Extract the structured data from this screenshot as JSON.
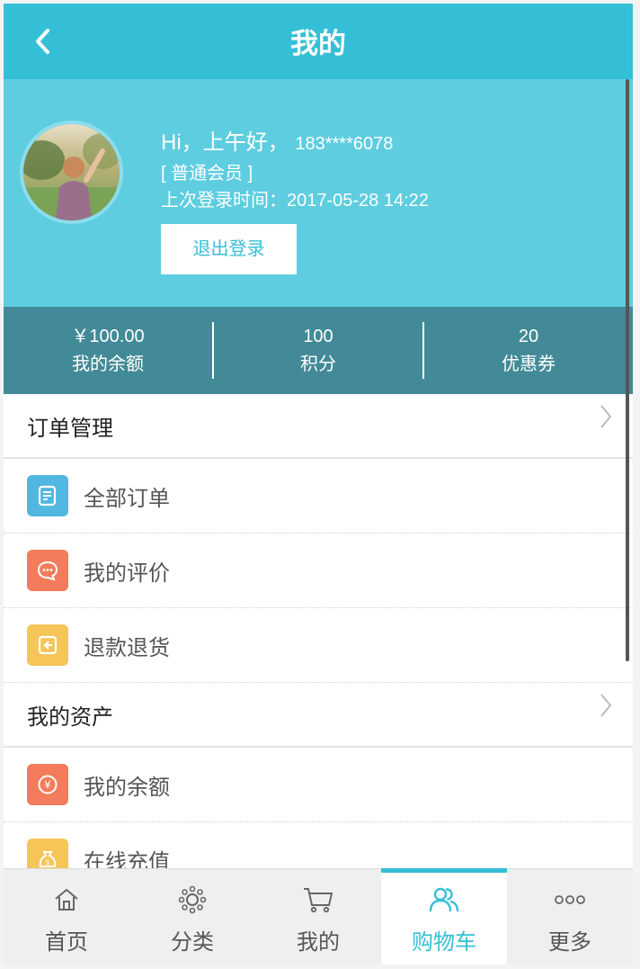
{
  "header": {
    "title": "我的"
  },
  "profile": {
    "greeting": "Hi，上午好，",
    "phone": "183****6078",
    "level": "[ 普通会员 ]",
    "last_login": "上次登录时间：2017-05-28 14:22",
    "logout_label": "退出登录"
  },
  "stats": [
    {
      "value": "￥100.00",
      "label": "我的余额"
    },
    {
      "value": "100",
      "label": "积分"
    },
    {
      "value": "20",
      "label": "优惠券"
    }
  ],
  "sections": {
    "orders": {
      "title": "订单管理",
      "items": [
        {
          "label": "全部订单",
          "icon": "order-list-icon",
          "color": "#52b7e0"
        },
        {
          "label": "我的评价",
          "icon": "comment-icon",
          "color": "#f27c5b"
        },
        {
          "label": "退款退货",
          "icon": "refund-icon",
          "color": "#f6c558"
        }
      ]
    },
    "assets": {
      "title": "我的资产",
      "items": [
        {
          "label": "我的余额",
          "icon": "yen-coin-icon",
          "color": "#f27c5b"
        },
        {
          "label": "在线充值",
          "icon": "money-bag-icon",
          "color": "#f6c558"
        }
      ]
    }
  },
  "nav": [
    {
      "label": "首页",
      "icon": "home-icon"
    },
    {
      "label": "分类",
      "icon": "category-icon"
    },
    {
      "label": "我的",
      "icon": "cart-icon"
    },
    {
      "label": "购物车",
      "icon": "users-icon",
      "active": true
    },
    {
      "label": "更多",
      "icon": "more-icon"
    }
  ],
  "colors": {
    "primary": "#35bfd6",
    "profile_bg": "#5ecde0",
    "stats_bg": "#428a97"
  }
}
